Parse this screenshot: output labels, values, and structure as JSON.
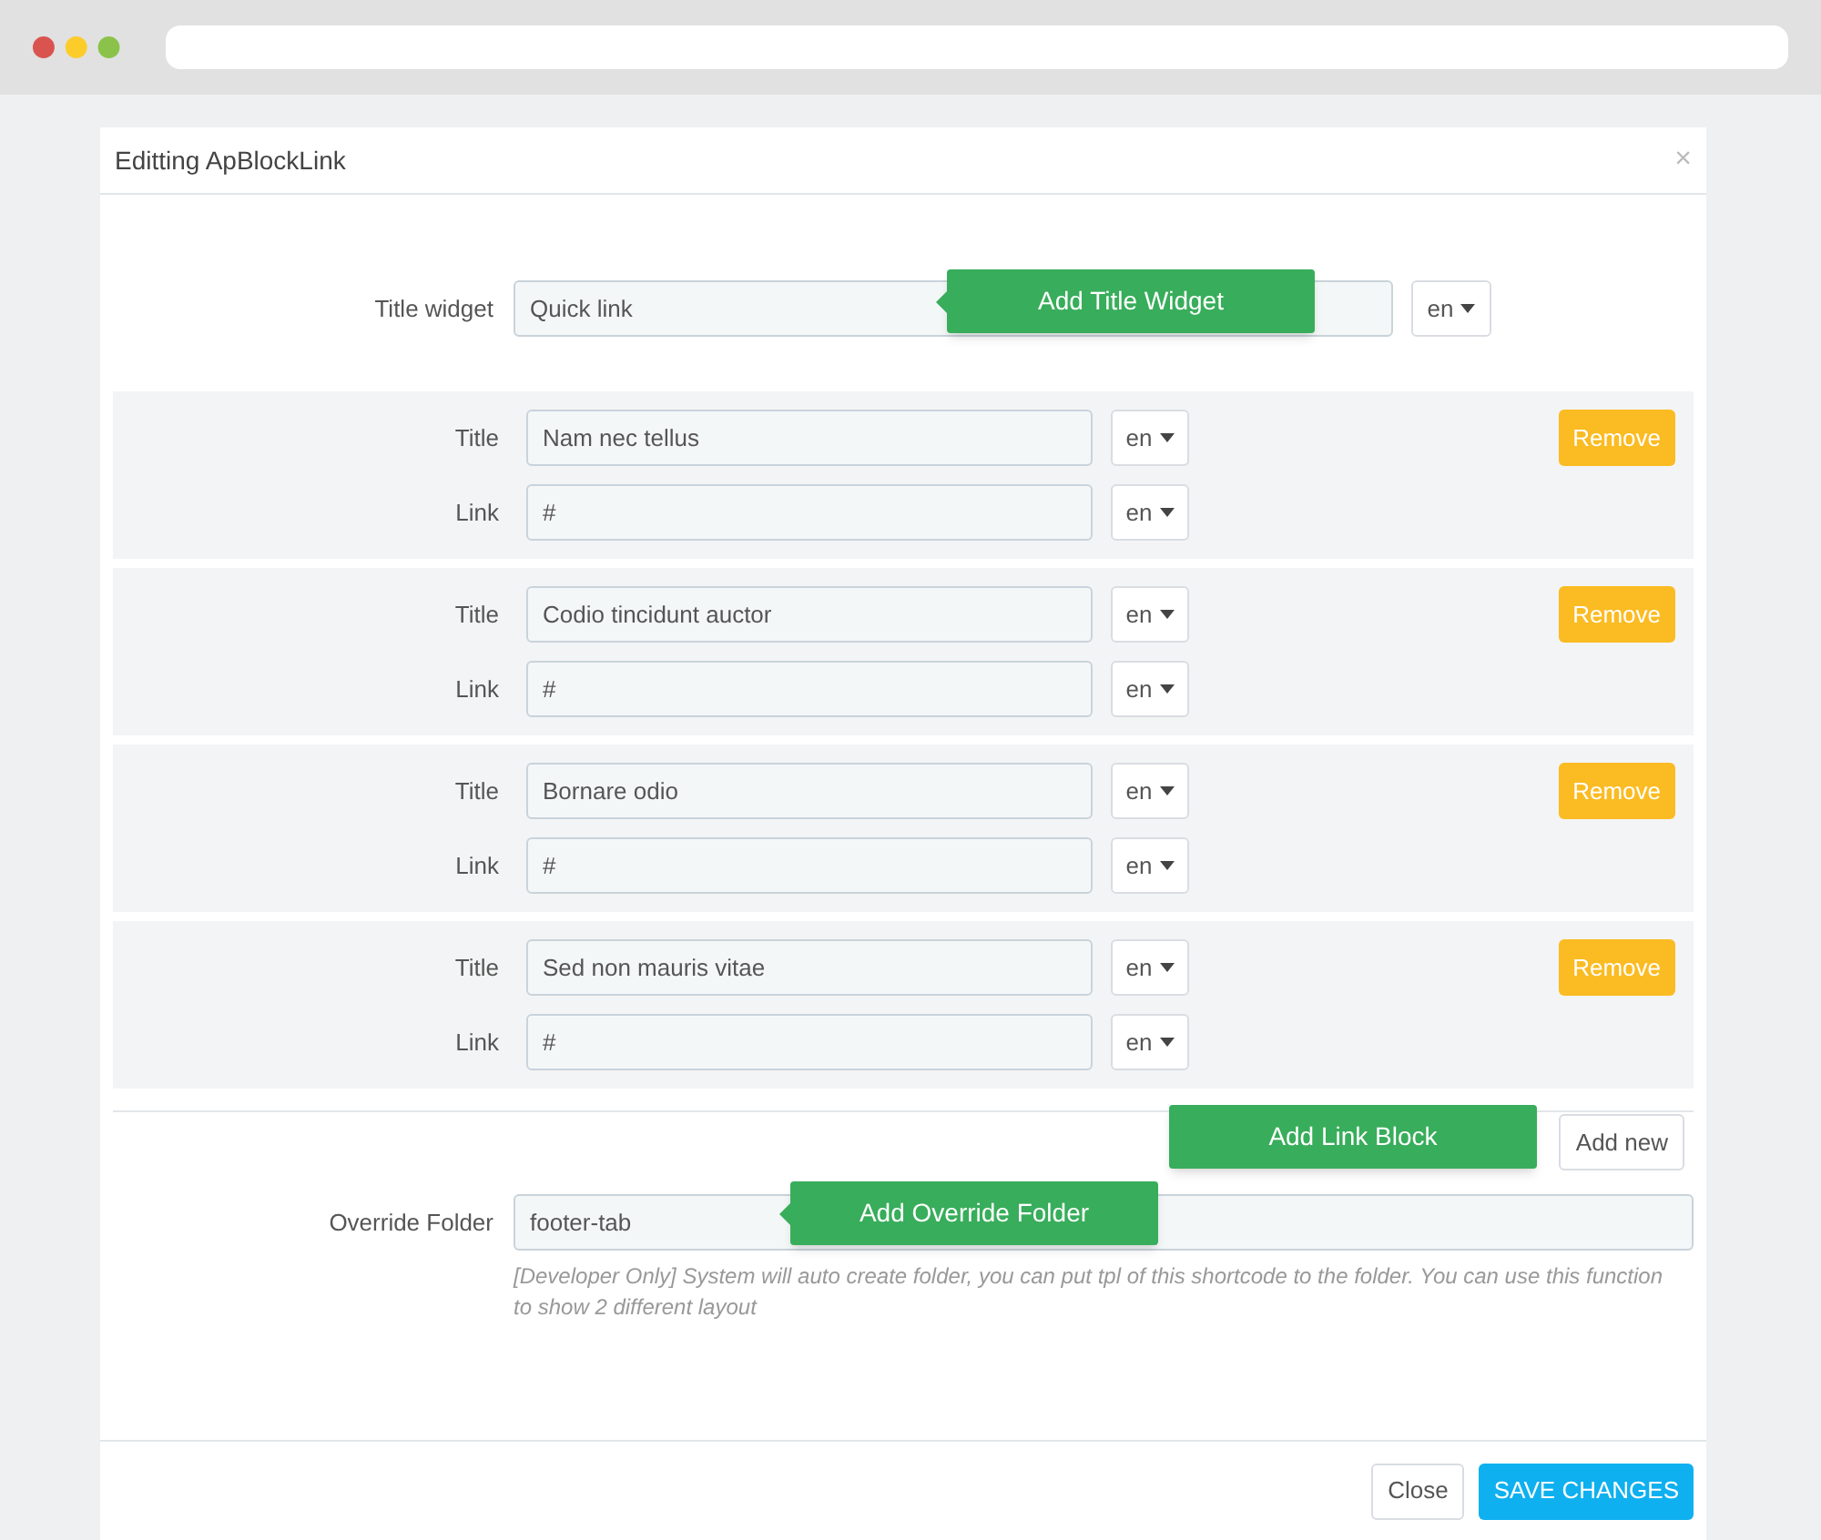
{
  "modal": {
    "title": "Editting ApBlockLink",
    "close": "×"
  },
  "title_widget": {
    "label": "Title widget",
    "value": "Quick link",
    "language": "en",
    "tooltip": "Add Title Widget"
  },
  "link_blocks": [
    {
      "title_label": "Title",
      "title_value": "Nam nec tellus",
      "title_language": "en",
      "link_label": "Link",
      "link_value": "#",
      "link_language": "en",
      "remove": "Remove"
    },
    {
      "title_label": "Title",
      "title_value": "Codio tincidunt auctor",
      "title_language": "en",
      "link_label": "Link",
      "link_value": "#",
      "link_language": "en",
      "remove": "Remove"
    },
    {
      "title_label": "Title",
      "title_value": "Bornare odio",
      "title_language": "en",
      "link_label": "Link",
      "link_value": "#",
      "link_language": "en",
      "remove": "Remove"
    },
    {
      "title_label": "Title",
      "title_value": "Sed non mauris vitae",
      "title_language": "en",
      "link_label": "Link",
      "link_value": "#",
      "link_language": "en",
      "remove": "Remove"
    }
  ],
  "add_new": {
    "button": "Add new",
    "tooltip": "Add Link Block"
  },
  "override_folder": {
    "label": "Override Folder",
    "value": "footer-tab",
    "tooltip": "Add Override Folder",
    "help": "[Developer Only] System will auto create folder, you can put tpl of this shortcode to the folder. You can use this function to show 2 different layout"
  },
  "footer": {
    "close": "Close",
    "save": "SAVE CHANGES"
  }
}
